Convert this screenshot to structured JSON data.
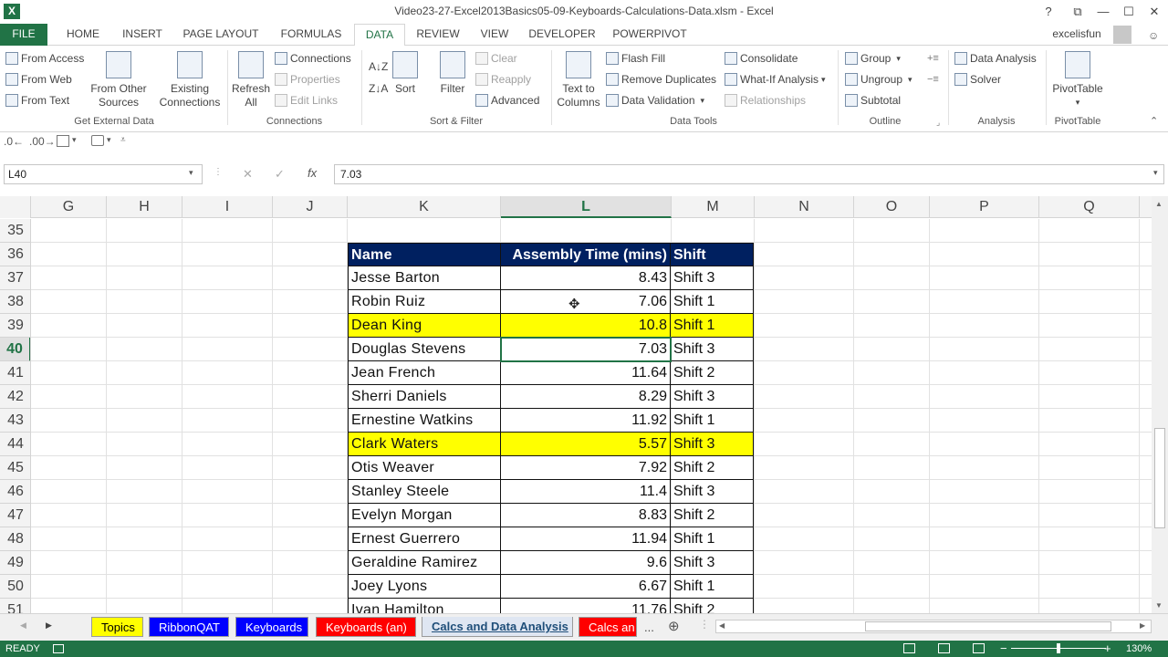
{
  "window": {
    "title": "Video23-27-Excel2013Basics05-09-Keyboards-Calculations-Data.xlsm - Excel",
    "logo": "X",
    "help": "?",
    "restore_ribbon": "⧉",
    "minimize": "—",
    "maximize": "☐",
    "close": "✕"
  },
  "tabs": [
    "FILE",
    "HOME",
    "INSERT",
    "PAGE LAYOUT",
    "FORMULAS",
    "DATA",
    "REVIEW",
    "VIEW",
    "DEVELOPER",
    "POWERPIVOT"
  ],
  "user": "excelisfun",
  "ribbon": {
    "get_external": {
      "from_access": "From Access",
      "from_web": "From Web",
      "from_text": "From Text",
      "from_other_1": "From Other",
      "from_other_2": "Sources",
      "existing_1": "Existing",
      "existing_2": "Connections",
      "label": "Get External Data"
    },
    "connections": {
      "refresh_1": "Refresh",
      "refresh_2": "All",
      "connections": "Connections",
      "properties": "Properties",
      "edit_links": "Edit Links",
      "label": "Connections"
    },
    "sort_filter": {
      "sort": "Sort",
      "filter": "Filter",
      "clear": "Clear",
      "reapply": "Reapply",
      "advanced": "Advanced",
      "label": "Sort & Filter"
    },
    "data_tools": {
      "text_1": "Text to",
      "text_2": "Columns",
      "flash_fill": "Flash Fill",
      "remove_dup": "Remove Duplicates",
      "validation": "Data Validation",
      "consolidate": "Consolidate",
      "what_if": "What-If Analysis",
      "relationships": "Relationships",
      "label": "Data Tools"
    },
    "outline": {
      "group": "Group",
      "ungroup": "Ungroup",
      "subtotal": "Subtotal",
      "label": "Outline"
    },
    "analysis": {
      "data_analysis": "Data Analysis",
      "solver": "Solver",
      "label": "Analysis"
    },
    "pivot": {
      "pivottable": "PivotTable",
      "label": "PivotTable"
    }
  },
  "formula_bar": {
    "name_box": "L40",
    "cancel": "✕",
    "enter": "✓",
    "fx": "fx",
    "value": "7.03"
  },
  "columns": [
    "G",
    "H",
    "I",
    "J",
    "K",
    "L",
    "M",
    "N",
    "O",
    "P",
    "Q"
  ],
  "rows": [
    "35",
    "36",
    "37",
    "38",
    "39",
    "40",
    "41",
    "42",
    "43",
    "44",
    "45",
    "46",
    "47",
    "48",
    "49",
    "50",
    "51"
  ],
  "table": {
    "headers": [
      "Name",
      "Assembly Time (mins)",
      "Shift"
    ],
    "rows": [
      {
        "name": "Jesse  Barton",
        "time": "8.43",
        "shift": "Shift 3"
      },
      {
        "name": "Robin  Ruiz",
        "time": "7.06",
        "shift": "Shift 1"
      },
      {
        "name": "Dean  King",
        "time": "10.8",
        "shift": "Shift 1"
      },
      {
        "name": "Douglas  Stevens",
        "time": "7.03",
        "shift": "Shift 3"
      },
      {
        "name": "Jean  French",
        "time": "11.64",
        "shift": "Shift 2"
      },
      {
        "name": "Sherri  Daniels",
        "time": "8.29",
        "shift": "Shift 3"
      },
      {
        "name": "Ernestine  Watkins",
        "time": "11.92",
        "shift": "Shift 1"
      },
      {
        "name": "Clark  Waters",
        "time": "5.57",
        "shift": "Shift 3"
      },
      {
        "name": "Otis  Weaver",
        "time": "7.92",
        "shift": "Shift 2"
      },
      {
        "name": "Stanley  Steele",
        "time": "11.4",
        "shift": "Shift 3"
      },
      {
        "name": "Evelyn  Morgan",
        "time": "8.83",
        "shift": "Shift 2"
      },
      {
        "name": "Ernest  Guerrero",
        "time": "11.94",
        "shift": "Shift 1"
      },
      {
        "name": "Geraldine  Ramirez",
        "time": "9.6",
        "shift": "Shift 3"
      },
      {
        "name": "Joey  Lyons",
        "time": "6.67",
        "shift": "Shift 1"
      },
      {
        "name": "Ivan  Hamilton",
        "time": "11.76",
        "shift": "Shift 2"
      }
    ],
    "highlight_color": "#ffff00",
    "header_color": "#002060"
  },
  "sheet_tabs": [
    {
      "label": "Topics",
      "bg": "#ffff00",
      "fg": "#000000"
    },
    {
      "label": "RibbonQAT",
      "bg": "#0000ff",
      "fg": "#ffffff"
    },
    {
      "label": "Keyboards",
      "bg": "#0000ff",
      "fg": "#ffffff"
    },
    {
      "label": "Keyboards (an)",
      "bg": "#ff0000",
      "fg": "#ffffff"
    },
    {
      "label": "Calcs and Data Analysis",
      "bg": "#dfe6f2",
      "fg": "#1f4e79"
    },
    {
      "label": "Calcs an",
      "bg": "#ff0000",
      "fg": "#ffffff"
    }
  ],
  "sheet_nav": {
    "more": "...",
    "add": "⊕"
  },
  "status": {
    "mode": "READY",
    "zoom": "130%"
  },
  "accent_color": "#217346"
}
